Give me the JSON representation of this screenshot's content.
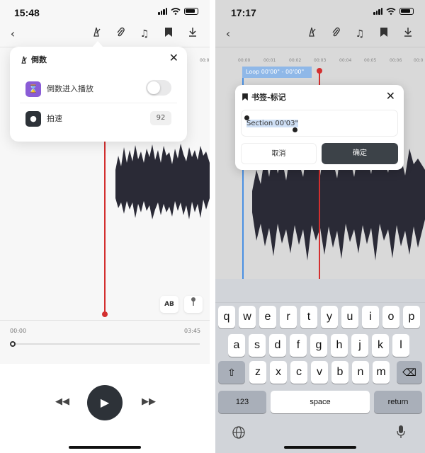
{
  "left": {
    "time": "15:48",
    "popover": {
      "title": "倒数",
      "rows": [
        {
          "label": "倒数进入播放"
        },
        {
          "label": "拍速",
          "value": "92"
        }
      ]
    },
    "controls": {
      "ab": "AB",
      "start_time": "00:00",
      "end_time": "03:45"
    },
    "ticks": [
      "00:0"
    ]
  },
  "right": {
    "time": "17:17",
    "ticks": [
      "00:00",
      "00:01",
      "00:02",
      "00:03",
      "00:04",
      "00:05",
      "00:06",
      "00:0"
    ],
    "loop": "Loop 00'00\" - 00'00\"",
    "dialog": {
      "title": "书签-标记",
      "input_value": "Section 00'03\"",
      "cancel": "取消",
      "confirm": "确定"
    },
    "keyboard": {
      "row1": [
        "q",
        "w",
        "e",
        "r",
        "t",
        "y",
        "u",
        "i",
        "o",
        "p"
      ],
      "row2": [
        "a",
        "s",
        "d",
        "f",
        "g",
        "h",
        "j",
        "k",
        "l"
      ],
      "row3": [
        "z",
        "x",
        "c",
        "v",
        "b",
        "n",
        "m"
      ],
      "numbers": "123",
      "space": "space",
      "return": "return"
    }
  },
  "colors": {
    "accent": "#d32f2f",
    "dark": "#2d3238",
    "loop": "#8fb8e8"
  }
}
